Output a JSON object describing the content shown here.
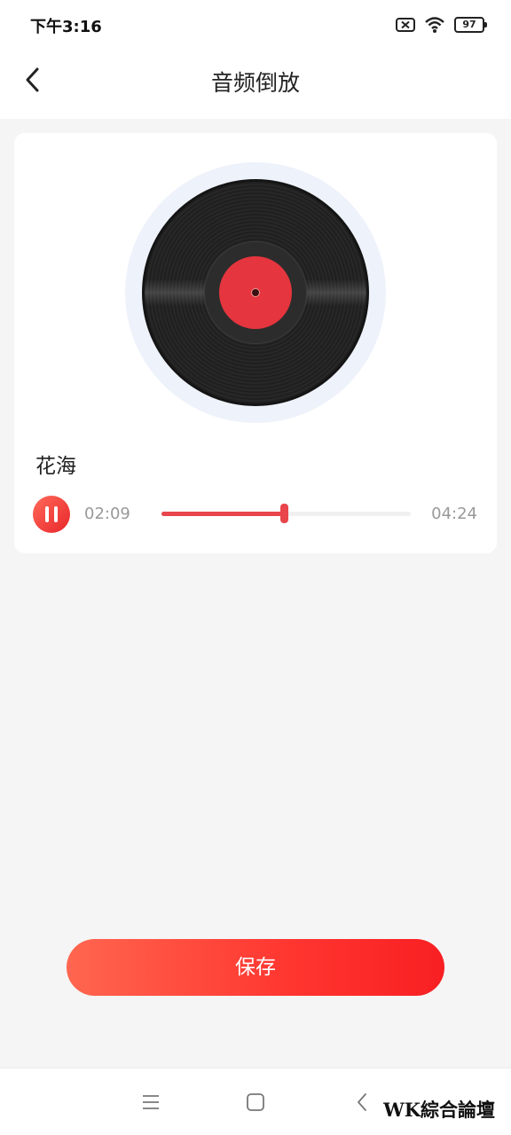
{
  "status_bar": {
    "time": "下午3:16",
    "battery_level": "97",
    "icons": [
      "sim-x-icon",
      "wifi-icon",
      "battery-icon"
    ]
  },
  "header": {
    "title": "音频倒放",
    "back_icon": "chevron-left-icon"
  },
  "player": {
    "song_title": "花海",
    "current_time": "02:09",
    "total_time": "04:24",
    "progress": 0.49,
    "state_icon": "pause-icon",
    "disc_icon": "vinyl-record-icon"
  },
  "actions": {
    "save_label": "保存"
  },
  "nav_bar": {
    "icons": [
      "menu-icon",
      "home-square-icon",
      "back-chevron-icon"
    ]
  },
  "watermark": "WK綜合論壇",
  "colors": {
    "accent": "#f0282a",
    "accent_light": "#ff6650",
    "disc_label": "#e5353e",
    "background": "#f5f5f5"
  }
}
